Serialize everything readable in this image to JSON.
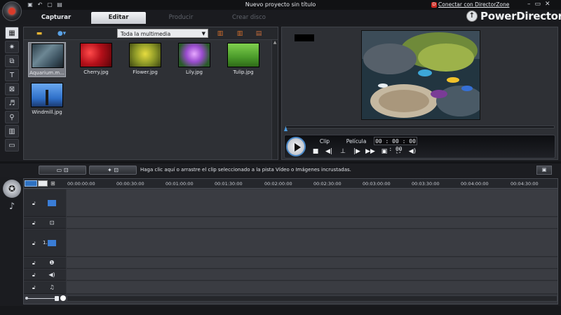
{
  "window": {
    "title": "Nuevo proyecto sin título",
    "directorzone": "Conectar con DirectorZone",
    "brand": "PowerDirector",
    "controls": [
      "–",
      "▭",
      "✕"
    ]
  },
  "tabs": [
    {
      "label": "Capturar",
      "state": "normal"
    },
    {
      "label": "Editar",
      "state": "active"
    },
    {
      "label": "Producir",
      "state": "disabled"
    },
    {
      "label": "Crear disco",
      "state": "disabled"
    }
  ],
  "library": {
    "filter": "Toda la multimedia",
    "items": [
      {
        "label": "Aquarium.m...",
        "selected": true,
        "color": "#4f6a7c"
      },
      {
        "label": "Cherry.jpg",
        "selected": false,
        "color": "#c41b1b"
      },
      {
        "label": "Flower.jpg",
        "selected": false,
        "color": "#9aa52a"
      },
      {
        "label": "Lily.jpg",
        "selected": false,
        "color": "#8a4db8"
      },
      {
        "label": "Tulip.jpg",
        "selected": false,
        "color": "#4d9e2f"
      },
      {
        "label": "Windmill.jpg",
        "selected": false,
        "color": "#3f7fd1"
      }
    ]
  },
  "preview": {
    "mode_clip": "Clip",
    "mode_movie": "Película",
    "timecode": "00 : 00 : 00 : 00"
  },
  "timeline": {
    "hint": "Haga clic aquí o arrastre el clip seleccionado a la pista Vídeo o Imágenes incrustadas.",
    "ticks": [
      "00:00:00:00",
      "00:00:30:00",
      "00:01:00:00",
      "00:01:30:00",
      "00:02:00:00",
      "00:02:30:00",
      "00:03:00:00",
      "00:03:30:00",
      "00:04:00:00",
      "00:04:30:00"
    ],
    "tracks": [
      {
        "name": "video",
        "icon": "video-track-icon",
        "label": ""
      },
      {
        "name": "effect",
        "icon": "effect-track-icon",
        "label": ""
      },
      {
        "name": "pip",
        "icon": "pip-track-icon",
        "label": "1."
      },
      {
        "name": "title",
        "icon": "title-track-icon",
        "label": ""
      },
      {
        "name": "voice",
        "icon": "voice-track-icon",
        "label": ""
      },
      {
        "name": "music",
        "icon": "music-track-icon",
        "label": ""
      }
    ]
  },
  "colors": {
    "accent": "#4b9be0",
    "background": "#1b1c20",
    "panel": "#2e3035"
  }
}
